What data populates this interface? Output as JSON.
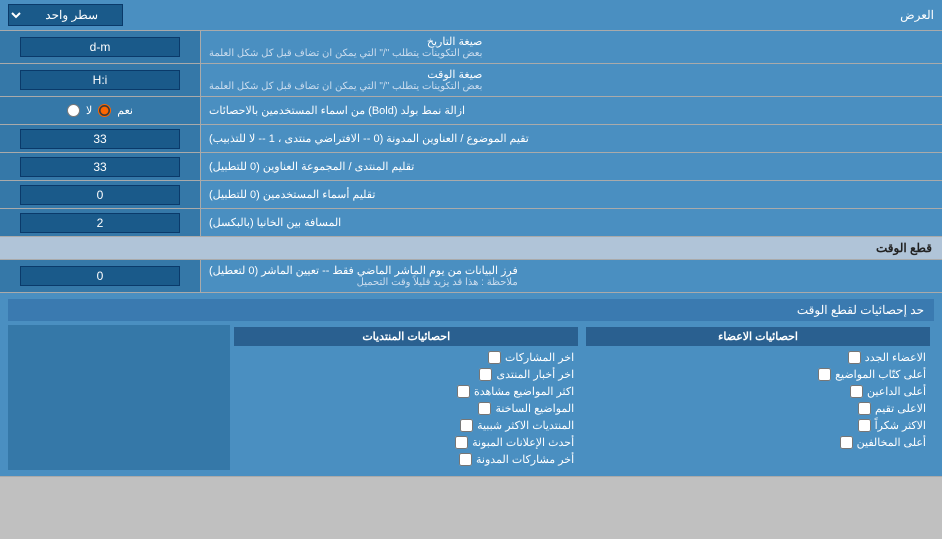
{
  "header": {
    "label_right": "العرض",
    "dropdown_label": "سطر واحد"
  },
  "rows": [
    {
      "id": "date-format",
      "label": "صيغة التاريخ",
      "sublabel": "بعض التكوينات يتطلب \"/\" التي يمكن ان تضاف قبل كل شكل العلمة",
      "input_value": "d-m"
    },
    {
      "id": "time-format",
      "label": "صيغة الوقت",
      "sublabel": "بعض التكوينات يتطلب \"/\" التي يمكن ان تضاف قبل كل شكل العلمة",
      "input_value": "H:i"
    },
    {
      "id": "bold-remove",
      "label": "ازالة نمط بولد (Bold) من اسماء المستخدمين بالاحصائات",
      "type": "radio",
      "options": [
        "نعم",
        "لا"
      ],
      "selected": "نعم"
    },
    {
      "id": "topic-sort",
      "label": "تقيم الموضوع / العناوين المدونة (0 -- الافتراضي منتدى ، 1 -- لا للتذبيب)",
      "input_value": "33"
    },
    {
      "id": "forum-sort",
      "label": "تقليم المنتدى / المجموعة العناوين (0 للتطبيل)",
      "input_value": "33"
    },
    {
      "id": "user-names",
      "label": "تقليم أسماء المستخدمين (0 للتطبيل)",
      "input_value": "0"
    },
    {
      "id": "cell-distance",
      "label": "المسافة بين الخانيا (بالبكسل)",
      "input_value": "2"
    }
  ],
  "time_cut": {
    "section_title": "قطع الوقت",
    "row": {
      "label": "فرز البيانات من يوم الماشر الماضي فقط -- تعيين الماشر (0 لتعطيل)",
      "note": "ملاحظة : هذا قد يزيد قليلاً وقت التحميل",
      "input_value": "0"
    },
    "stats_title": "حد إحصائيات لقطع الوقت"
  },
  "stats_sections": {
    "posts": {
      "header": "احصائيات المنتديات",
      "items": [
        "اخر المشاركات",
        "اخر أخبار المنتدى",
        "اكثر المواضيع مشاهدة",
        "المواضيع الساخنة",
        "المنتديات الاكثر شببية",
        "أحدث الإعلانات المبونة",
        "أخر مشاركات المدونة"
      ]
    },
    "members": {
      "header": "احصائيات الاعضاء",
      "items": [
        "الاعضاء الجدد",
        "أعلى كتّاب المواضيع",
        "أعلى الداعين",
        "الاعلى تقيم",
        "الاكثر شكراً",
        "أعلى المخالفين"
      ]
    }
  },
  "colors": {
    "blue_dark": "#1a5a8a",
    "blue_mid": "#3578a8",
    "blue_light": "#4a8fc1",
    "section_bg": "#b0c8e0"
  }
}
